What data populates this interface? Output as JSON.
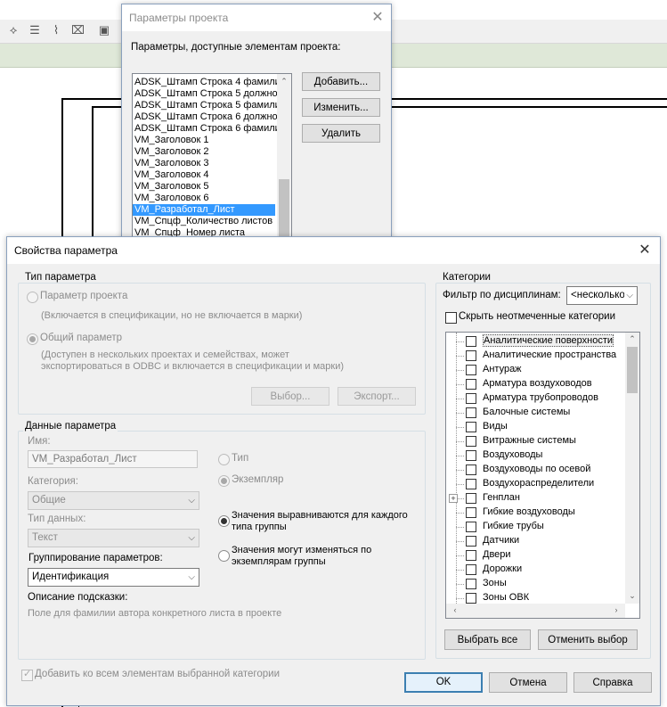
{
  "project_params_dialog": {
    "title": "Параметры проекта",
    "caption": "Параметры, доступные элементам проекта:",
    "items": [
      "ADSK_Штамп Строка 4 фамилия",
      "ADSK_Штамп Строка 5 должнос",
      "ADSK_Штамп Строка 5 фамилия",
      "ADSK_Штамп Строка 6 должнос",
      "ADSK_Штамп Строка 6 фамилия",
      "VM_Заголовок 1",
      "VM_Заголовок 2",
      "VM_Заголовок 3",
      "VM_Заголовок 4",
      "VM_Заголовок 5",
      "VM_Заголовок 6",
      "VM_Разработал_Лист",
      "VM_Спцф_Количество листов",
      "VM_Спцф_Номер листа"
    ],
    "selected_item": "VM_Разработал_Лист",
    "add_label": "Добавить...",
    "edit_label": "Изменить...",
    "delete_label": "Удалить"
  },
  "param_props_dialog": {
    "title": "Свойства параметра",
    "param_type": {
      "group_label": "Тип параметра",
      "project_param_label": "Параметр проекта",
      "project_param_desc": "(Включается в спецификации, но не включается в марки)",
      "shared_param_label": "Общий параметр",
      "shared_param_desc_1": "(Доступен в нескольких проектах и семействах, может",
      "shared_param_desc_2": "экспортироваться в ODBC и включается в спецификации и марки)",
      "select_label": "Выбор...",
      "export_label": "Экспорт..."
    },
    "param_data": {
      "group_label": "Данные параметра",
      "name_label": "Имя:",
      "name_value": "VM_Разработал_Лист",
      "category_label": "Категория:",
      "category_value": "Общие",
      "datatype_label": "Тип данных:",
      "datatype_value": "Текст",
      "grouping_label": "Группирование параметров:",
      "grouping_value": "Идентификация",
      "tooltip_label": "Описание подсказки:",
      "tooltip_value": "Поле для фамилии автора конкретного листа в проекте",
      "type_label": "Тип",
      "instance_label": "Экземпляр",
      "align_label_1": "Значения выравниваются для каждого",
      "align_label_2": "типа группы",
      "vary_label_1": "Значения могут изменяться по",
      "vary_label_2": "экземплярам группы"
    },
    "categories": {
      "group_label": "Категории",
      "filter_label": "Фильтр по дисциплинам:",
      "filter_value": "<несколько>",
      "hide_unchecked_label": "Скрыть неотмеченные категории",
      "items": [
        "Аналитические поверхности",
        "Аналитические пространства",
        "Антураж",
        "Арматура воздуховодов",
        "Арматура трубопроводов",
        "Балочные системы",
        "Виды",
        "Витражные системы",
        "Воздуховоды",
        "Воздуховоды по осевой",
        "Воздухораспределители",
        "Генплан",
        "Гибкие воздуховоды",
        "Гибкие трубы",
        "Датчики",
        "Двери",
        "Дорожки",
        "Зоны",
        "Зоны ОВК"
      ],
      "select_all_label": "Выбрать все",
      "clear_label": "Отменить выбор"
    },
    "add_all_label": "Добавить ко всем элементам выбранной категории",
    "ok_label": "OK",
    "cancel_label": "Отмена",
    "help_label": "Справка"
  }
}
